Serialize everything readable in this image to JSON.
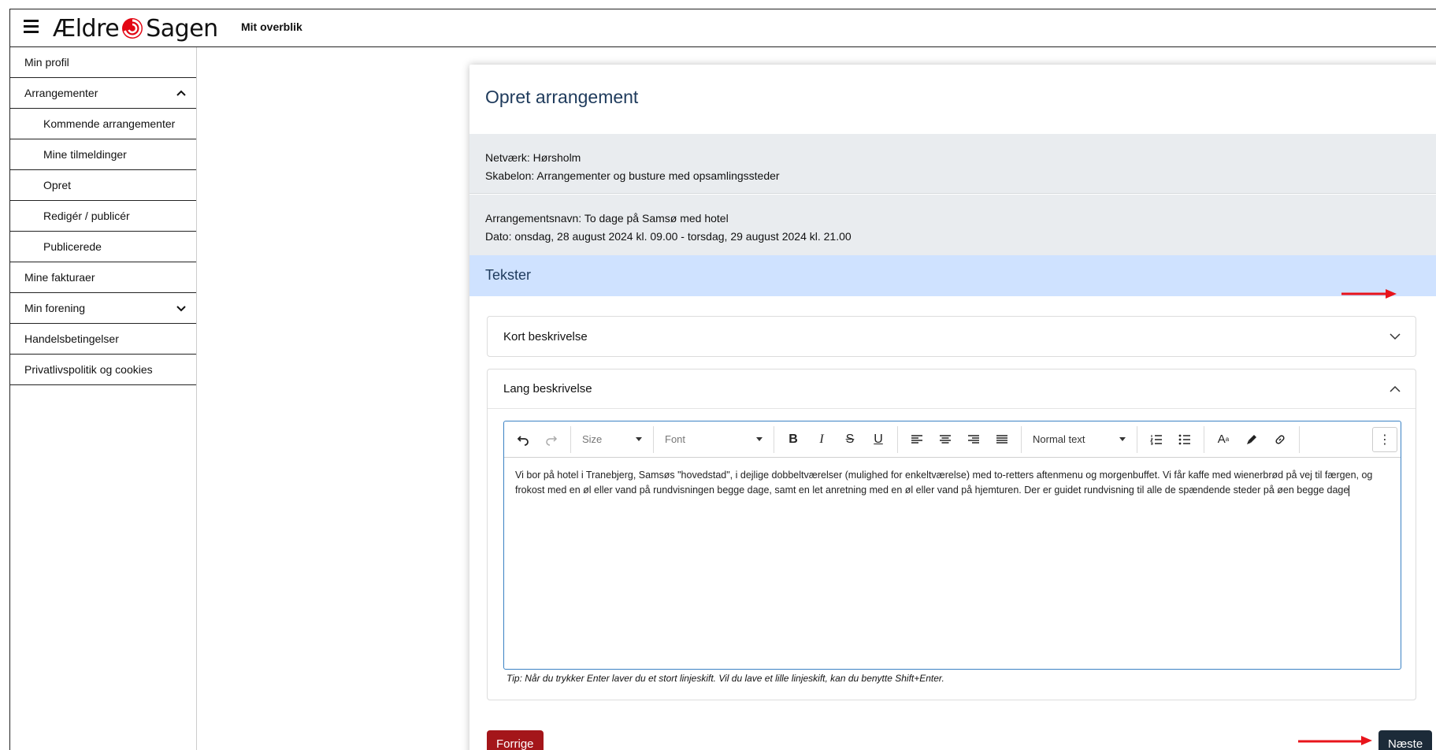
{
  "header": {
    "logo_left": "Ældre",
    "logo_right": "Sagen",
    "nav_label": "Mit overblik"
  },
  "sidebar": {
    "items": [
      {
        "label": "Min profil"
      },
      {
        "label": "Arrangementer"
      },
      {
        "label": "Kommende arrangementer"
      },
      {
        "label": "Mine tilmeldinger"
      },
      {
        "label": "Opret"
      },
      {
        "label": "Redigér / publicér"
      },
      {
        "label": "Publicerede"
      },
      {
        "label": "Mine fakturaer"
      },
      {
        "label": "Min forening"
      },
      {
        "label": "Handelsbetingelser"
      },
      {
        "label": "Privatlivspolitik og cookies"
      }
    ]
  },
  "card": {
    "title": "Opret arrangement",
    "network": "Netværk: Hørsholm",
    "template": "Skabelon: Arrangementer og busture med opsamlingssteder",
    "event_name": "Arrangementsnavn: To dage på Samsø med hotel",
    "date": "Dato: onsdag, 28 august 2024 kl. 09.00 - torsdag, 29 august 2024 kl. 21.00",
    "section_title": "Tekster",
    "accordion_short": "Kort beskrivelse",
    "accordion_long": "Lang beskrivelse",
    "editor": {
      "size_placeholder": "Size",
      "font_placeholder": "Font",
      "style_value": "Normal text",
      "content": "Vi bor på hotel i Tranebjerg, Samsøs \"hovedstad\", i dejlige dobbeltværelser (mulighed for enkeltværelse) med to-retters aftenmenu og morgenbuffet. Vi får kaffe med wienerbrød på vej til færgen, og frokost med en øl eller vand på rundvisningen begge dage, samt en let anretning med en øl eller vand på hjemturen. Der er guidet rundvisning til alle de spændende steder på øen begge dage"
    },
    "tip": "Tip: Når du trykker Enter laver du et stort linjeskift. Vil du lave et lille linjeskift, kan du benytte Shift+Enter.",
    "prev_button": "Forrige",
    "next_button": "Næste"
  },
  "colors": {
    "brand_red": "#e30613",
    "prev_button": "#a4161a",
    "next_button": "#1c2b39",
    "section_band": "#cfe2ff",
    "annotation_arrow": "#e8141b"
  }
}
